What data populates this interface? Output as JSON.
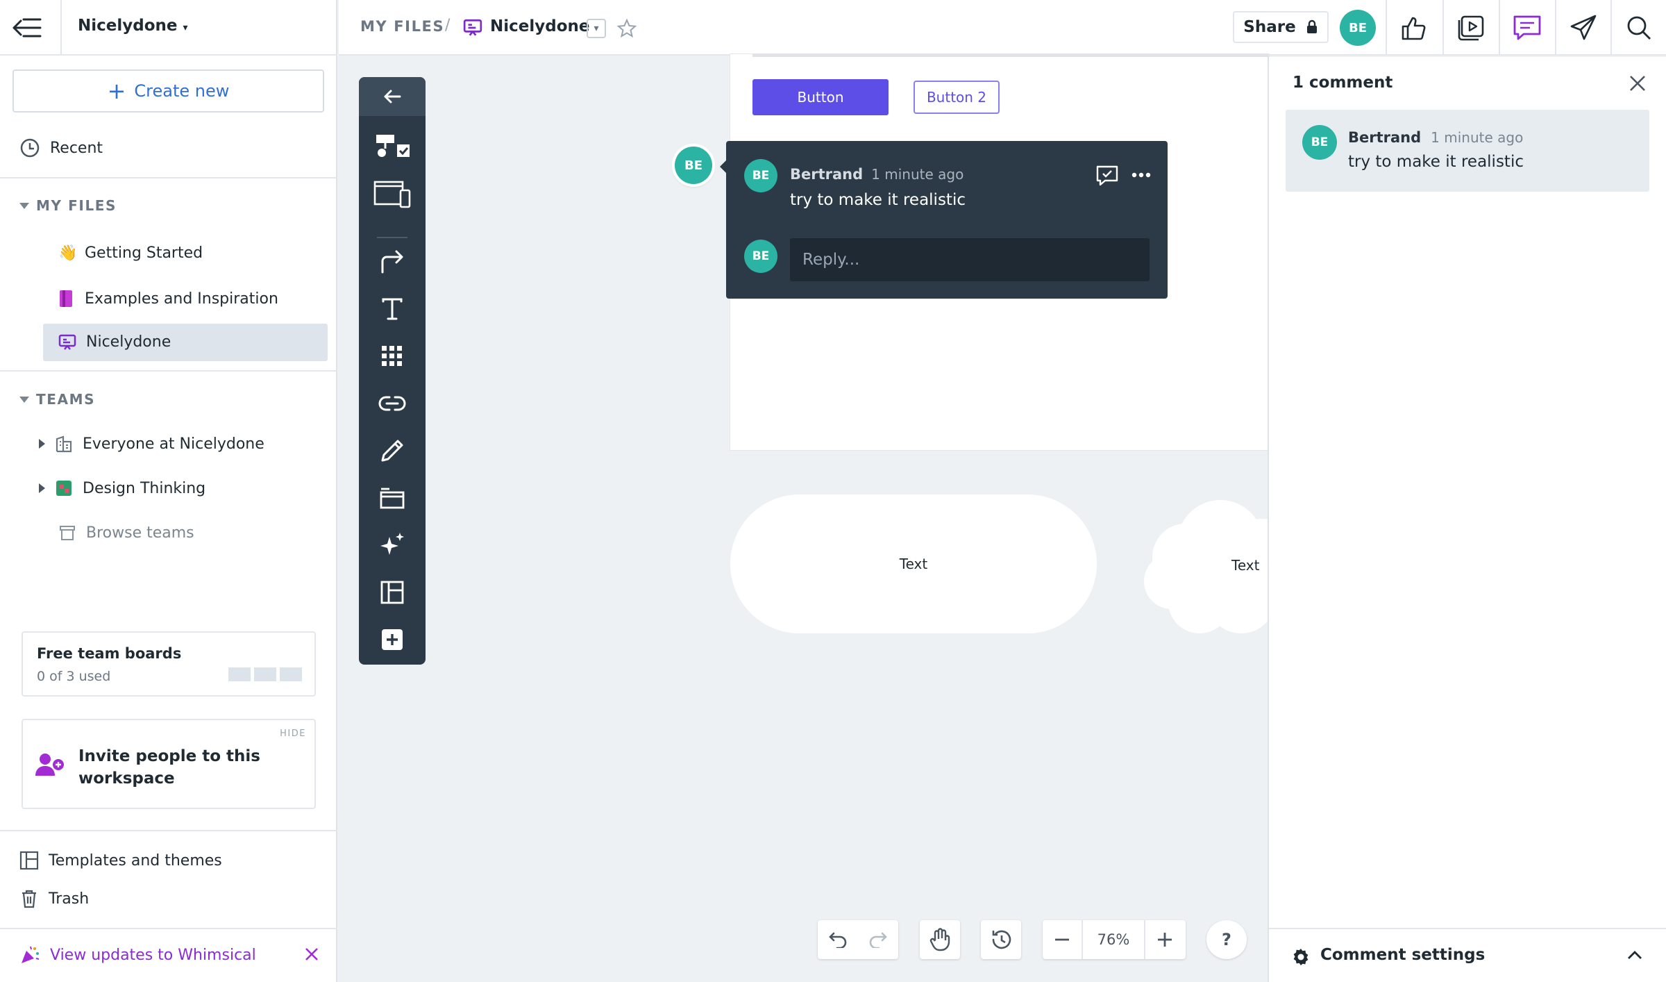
{
  "sidebar": {
    "workspace_name": "Nicelydone",
    "create_new": "Create new",
    "recent": "Recent",
    "my_files_header": "MY FILES",
    "my_files": [
      {
        "emoji": "👋",
        "label": "Getting Started"
      },
      {
        "label": "Examples and Inspiration"
      },
      {
        "label": "Nicelydone"
      }
    ],
    "teams_header": "TEAMS",
    "teams": [
      {
        "label": "Everyone at Nicelydone"
      },
      {
        "label": "Design Thinking"
      }
    ],
    "browse_teams": "Browse teams",
    "free_boards": {
      "title": "Free team boards",
      "usage": "0 of 3 used",
      "used": 0,
      "total": 3
    },
    "invite": {
      "hide": "HIDE",
      "text_line1": "Invite people to this",
      "text_line2": "workspace"
    },
    "templates": "Templates and themes",
    "trash": "Trash",
    "updates": "View updates to Whimsical"
  },
  "topbar": {
    "breadcrumb_root": "MY FILES",
    "breadcrumb_sep": "/",
    "file_name": "Nicelydone",
    "share_label": "Share",
    "avatar_initials": "BE"
  },
  "canvas": {
    "button1": "Button",
    "button2": "Button 2",
    "shape1_text": "Text",
    "shape2_text": "Text",
    "pin_initials": "BE"
  },
  "popup": {
    "author": "Bertrand",
    "time": "1 minute ago",
    "text": "try to make it realistic",
    "author_initials": "BE",
    "reply_initials": "BE",
    "reply_placeholder": "Reply..."
  },
  "panel": {
    "title": "1 comment",
    "comments": [
      {
        "initials": "BE",
        "author": "Bertrand",
        "time": "1 minute ago",
        "text": "try to make it realistic"
      }
    ],
    "settings": "Comment settings"
  },
  "controls": {
    "zoom": "76%",
    "help": "?"
  },
  "colors": {
    "accent_purple": "#5d4ee8",
    "link_blue": "#2f6fd6",
    "avatar_teal": "#2bb3a3",
    "toolbar_dark": "#2c3a47",
    "magenta": "#a22bd6"
  }
}
